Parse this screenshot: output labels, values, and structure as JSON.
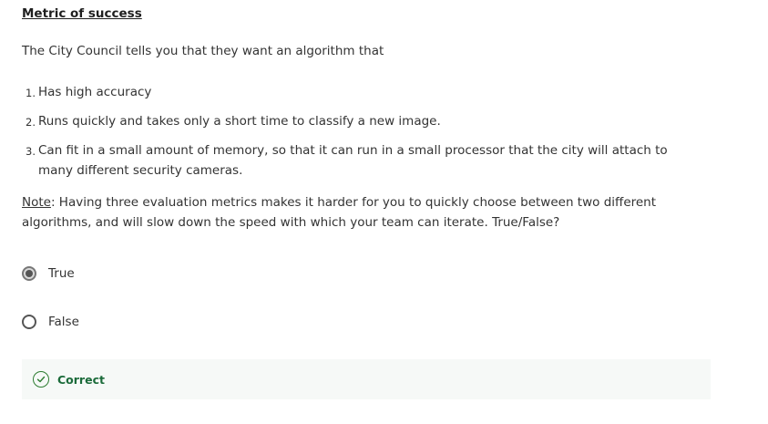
{
  "question": {
    "title": "Metric of success",
    "intro": "The City Council tells you that they want an algorithm that",
    "criteria": [
      {
        "number": "1.",
        "text": "Has high accuracy"
      },
      {
        "number": "2.",
        "text": "Runs quickly and takes only a short time to classify a new image."
      },
      {
        "number": "3.",
        "text": "Can fit in a small amount of memory, so that it can run in a small processor that the city will attach to many different security cameras."
      }
    ],
    "note_label": "Note",
    "note_text": ": Having three evaluation metrics makes it harder for you to quickly choose between two different algorithms, and will slow down the speed with which your team can iterate. True/False?"
  },
  "options": [
    {
      "label": "True",
      "selected": true
    },
    {
      "label": "False",
      "selected": false
    }
  ],
  "feedback": {
    "status": "Correct",
    "icon": "check-circle-icon",
    "color": "#1b6b3a",
    "background": "#f6f9f7"
  }
}
